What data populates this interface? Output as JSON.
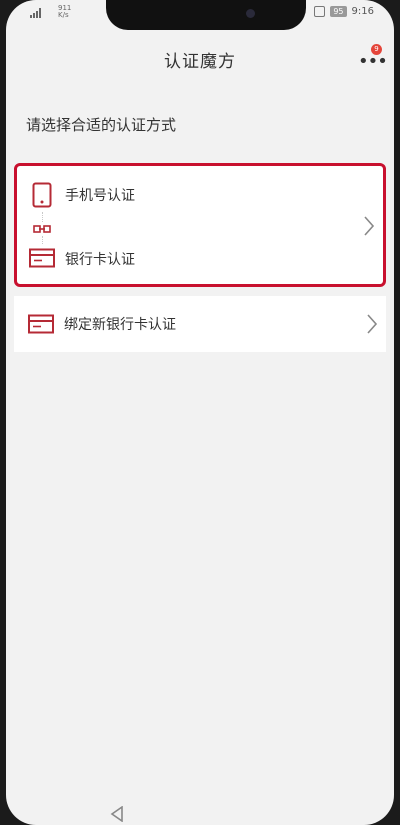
{
  "status": {
    "network_speed": "911 K/s",
    "battery": "95",
    "time": "9:16"
  },
  "nav": {
    "title": "认证魔方",
    "more_icon": "more-horizontal-icon",
    "badge_count": "9"
  },
  "prompt": "请选择合适的认证方式",
  "options": {
    "combined": {
      "phone_label": "手机号认证",
      "card_label": "银行卡认证",
      "phone_icon": "phone-icon",
      "card_icon": "bank-card-icon",
      "link_icon": "link-icon",
      "highlight_color": "#c8102e"
    },
    "bind_card_label": "绑定新银行卡认证",
    "bind_card_icon": "bank-card-icon"
  },
  "accent_color": "#b52a35"
}
